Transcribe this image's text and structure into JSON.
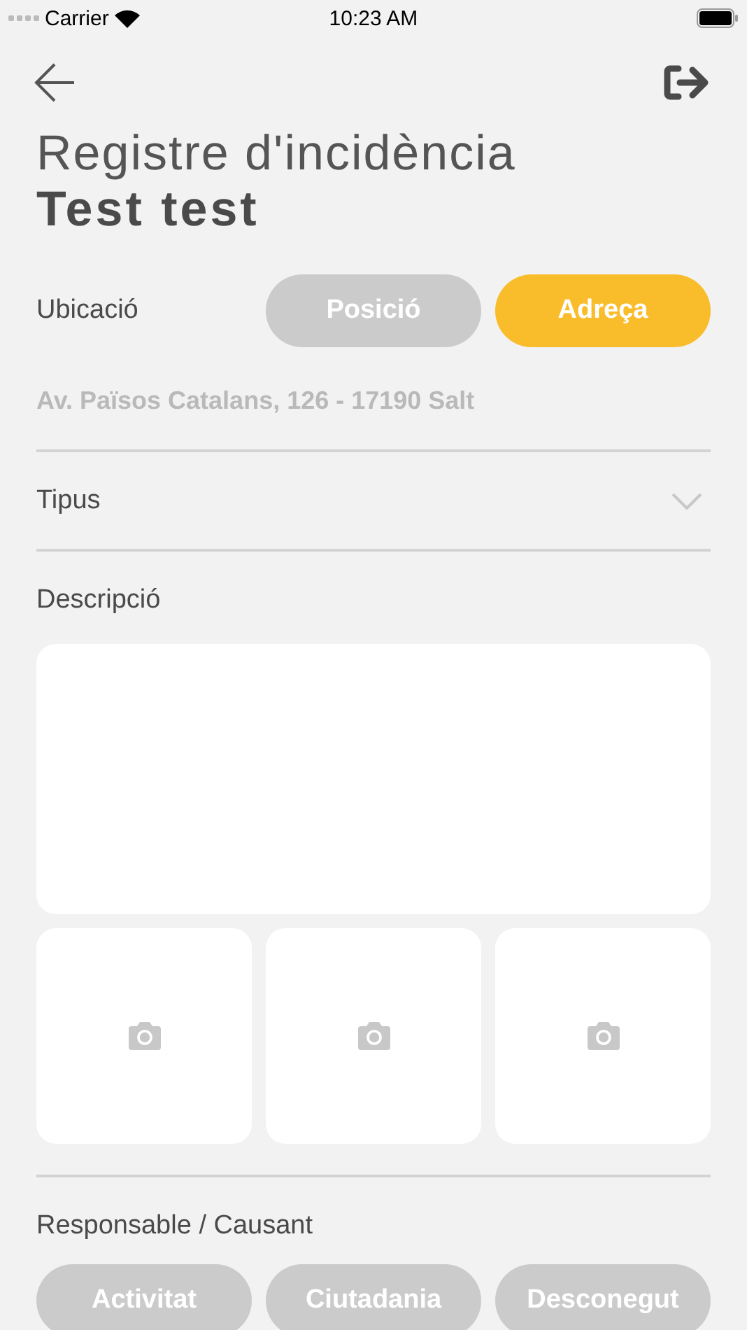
{
  "status_bar": {
    "carrier": "Carrier",
    "time": "10:23 AM"
  },
  "title": "Registre d'incidència",
  "subtitle": "Test test",
  "location": {
    "label": "Ubicació",
    "options": [
      {
        "label": "Posició",
        "selected": false
      },
      {
        "label": "Adreça",
        "selected": true
      }
    ],
    "address": "Av. Països Catalans, 126 - 17190 Salt"
  },
  "type_field": {
    "label": "Tipus"
  },
  "description": {
    "label": "Descripció"
  },
  "photos": [
    {
      "kind": "empty"
    },
    {
      "kind": "empty"
    },
    {
      "kind": "empty"
    }
  ],
  "responsible": {
    "label": "Responsable / Causant",
    "options": [
      {
        "label": "Activitat",
        "selected": false
      },
      {
        "label": "Ciutadania",
        "selected": false
      },
      {
        "label": "Desconegut",
        "selected": false
      }
    ]
  }
}
